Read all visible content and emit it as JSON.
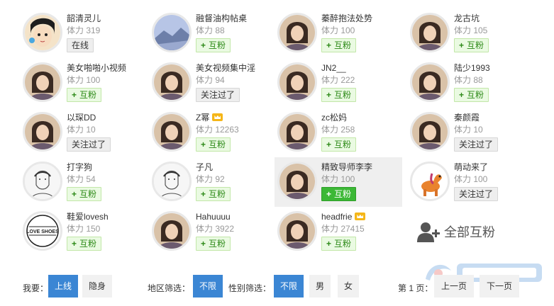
{
  "users": [
    {
      "name": "韶清灵儿",
      "stamina": "体力 319",
      "action": "在线",
      "type": "state",
      "crown": false,
      "highlight": false,
      "avatar": "cartoon-avatar",
      "col": 0,
      "row": 0
    },
    {
      "name": "融督油构帖桌",
      "stamina": "体力 88",
      "action": "互粉",
      "type": "mutual",
      "crown": false,
      "highlight": false,
      "avatar": "landscape-avatar",
      "col": 1,
      "row": 0
    },
    {
      "name": "蓁醉抱法处势",
      "stamina": "体力 100",
      "action": "互粉",
      "type": "mutual",
      "crown": false,
      "highlight": false,
      "avatar": "photo-avatar",
      "col": 2,
      "row": 0
    },
    {
      "name": "龙古坑",
      "stamina": "体力 105",
      "action": "互粉",
      "type": "mutual",
      "crown": false,
      "highlight": false,
      "avatar": "photo-avatar",
      "col": 3,
      "row": 0
    },
    {
      "name": "美女啪啪小视频",
      "stamina": "体力 100",
      "action": "互粉",
      "type": "mutual",
      "crown": false,
      "highlight": false,
      "avatar": "photo-avatar",
      "col": 0,
      "row": 1
    },
    {
      "name": "美女视频集中淫",
      "stamina": "体力 94",
      "action": "关注过了",
      "type": "state",
      "crown": false,
      "highlight": false,
      "avatar": "photo-avatar",
      "col": 1,
      "row": 1
    },
    {
      "name": "JN2__",
      "stamina": "体力 222",
      "action": "互粉",
      "type": "mutual",
      "crown": false,
      "highlight": false,
      "avatar": "photo-avatar",
      "col": 2,
      "row": 1
    },
    {
      "name": "陆少1993",
      "stamina": "体力 88",
      "action": "互粉",
      "type": "mutual",
      "crown": false,
      "highlight": false,
      "avatar": "photo-avatar",
      "col": 3,
      "row": 1
    },
    {
      "name": "以琛DD",
      "stamina": "体力 10",
      "action": "关注过了",
      "type": "state",
      "crown": false,
      "highlight": false,
      "avatar": "photo-avatar",
      "col": 0,
      "row": 2
    },
    {
      "name": "Z幂",
      "stamina": "体力 12263",
      "action": "互粉",
      "type": "mutual",
      "crown": true,
      "highlight": false,
      "avatar": "photo-avatar",
      "col": 1,
      "row": 2
    },
    {
      "name": "zc松妈",
      "stamina": "体力 258",
      "action": "互粉",
      "type": "mutual",
      "crown": false,
      "highlight": false,
      "avatar": "photo-avatar",
      "col": 2,
      "row": 2
    },
    {
      "name": "秦颜霞",
      "stamina": "体力 10",
      "action": "关注过了",
      "type": "state",
      "crown": false,
      "highlight": false,
      "avatar": "photo-avatar",
      "col": 3,
      "row": 2
    },
    {
      "name": "打字狗",
      "stamina": "体力 54",
      "action": "互粉",
      "type": "mutual",
      "crown": false,
      "highlight": false,
      "avatar": "sketch-avatar",
      "col": 0,
      "row": 3
    },
    {
      "name": "子凡",
      "stamina": "体力 92",
      "action": "互粉",
      "type": "mutual",
      "crown": false,
      "highlight": false,
      "avatar": "sketch-avatar",
      "col": 1,
      "row": 3
    },
    {
      "name": "精致导师李李",
      "stamina": "体力 100",
      "action": "互粉",
      "type": "mutual",
      "crown": false,
      "highlight": true,
      "avatar": "photo-avatar",
      "col": 2,
      "row": 3
    },
    {
      "name": "萌动来了",
      "stamina": "体力 100",
      "action": "关注过了",
      "type": "state",
      "crown": false,
      "highlight": false,
      "avatar": "toy-horse-avatar",
      "col": 3,
      "row": 3
    },
    {
      "name": "鞋爱lovesh",
      "stamina": "体力 150",
      "action": "互粉",
      "type": "mutual",
      "crown": false,
      "highlight": false,
      "avatar": "logo-avatar",
      "logo_text": "LOVE SHOES",
      "col": 0,
      "row": 4
    },
    {
      "name": "Hahuuuu",
      "stamina": "体力 3922",
      "action": "互粉",
      "type": "mutual",
      "crown": false,
      "highlight": false,
      "avatar": "photo-avatar",
      "col": 1,
      "row": 4
    },
    {
      "name": "headfrie",
      "stamina": "体力 27415",
      "action": "互粉",
      "type": "mutual",
      "crown": true,
      "highlight": false,
      "avatar": "photo-avatar",
      "col": 2,
      "row": 4
    }
  ],
  "all_mutual": {
    "label": "全部互粉",
    "icon": "add-user-icon"
  },
  "footer": {
    "me_label": "我要：",
    "online_btn": "上线",
    "stealth_btn": "隐身",
    "region_label": "地区筛选：",
    "region_btn": "不限",
    "gender_label": "性别筛选：",
    "gender_any": "不限",
    "gender_male": "男",
    "gender_female": "女",
    "page_label": "第 1 页：",
    "prev_btn": "上一页",
    "next_btn": "下一页"
  },
  "colors": {
    "accent": "#3b86d4",
    "mutual_bg": "#eafae2",
    "mutual_text": "#2d8a18",
    "active_green": "#3cb836",
    "crown": "#f5b618"
  }
}
